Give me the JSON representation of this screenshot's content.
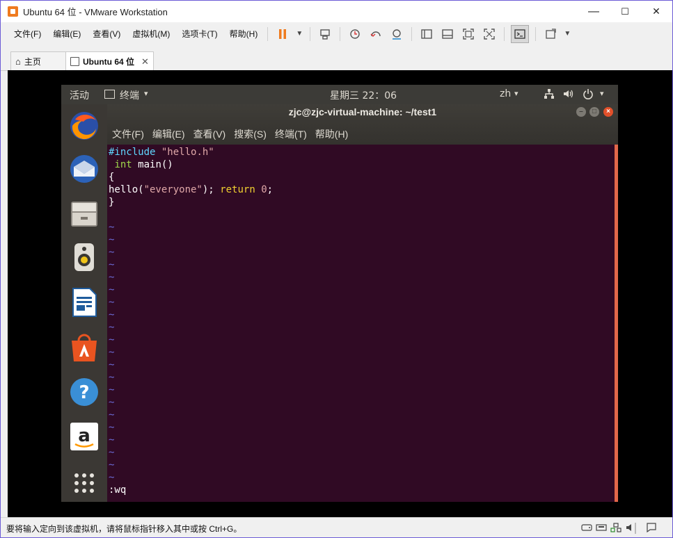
{
  "window": {
    "title": "Ubuntu 64 位 - VMware Workstation",
    "controls": {
      "minimize": "—",
      "maximize": "☐",
      "close": "✕"
    }
  },
  "menubar": {
    "items": [
      "文件(F)",
      "编辑(E)",
      "查看(V)",
      "虚拟机(M)",
      "选项卡(T)",
      "帮助(H)"
    ]
  },
  "toolbar": {
    "icons": [
      "pause-icon",
      "dropdown-arrow-icon",
      "send-ctrl-alt-del-icon",
      "snapshot-icon",
      "revert-snapshot-icon",
      "snapshot-manager-icon",
      "sidebar-icon",
      "thumbnail-bar-icon",
      "fullscreen-icon",
      "unity-icon",
      "console-view-icon",
      "stretch-icon",
      "dropdown-arrow-icon"
    ],
    "accent": "#ef7b1f"
  },
  "tabs": [
    {
      "label": "主页",
      "icon": "home-icon",
      "active": false
    },
    {
      "label": "Ubuntu 64 位",
      "icon": "vm-icon",
      "active": true,
      "close": "✕"
    }
  ],
  "ubuntu": {
    "topbar": {
      "activities": "活动",
      "app_menu": "终端",
      "clock": "星期三 22：06",
      "lang": "zh",
      "arrow": "▾"
    },
    "dock": [
      "firefox-icon",
      "thunderbird-icon",
      "files-icon",
      "rhythmbox-icon",
      "libreoffice-writer-icon",
      "software-center-icon",
      "help-icon",
      "amazon-icon",
      "show-apps-icon"
    ],
    "terminal": {
      "title": "zjc@zjc-virtual-machine: ~/test1",
      "menus": [
        "文件(F)",
        "编辑(E)",
        "查看(V)",
        "搜索(S)",
        "终端(T)",
        "帮助(H)"
      ],
      "vim": {
        "line1_directive": "#include",
        "line1_file": "\"hello.h\"",
        "line2_type": "int",
        "line2_rest": " main()",
        "line3": "{",
        "line4_call": "hello(",
        "line4_arg": "\"everyone\"",
        "line4_mid": "); ",
        "line4_return": "return",
        "line4_num": "0",
        "line4_end": ";",
        "line5": "}",
        "tilde": "~",
        "command": ":wq"
      },
      "colors": {
        "background": "#300a24",
        "scrollbar": "#e2674a"
      }
    }
  },
  "statusbar": {
    "text": "要将输入定向到该虚拟机，请将鼠标指针移入其中或按 Ctrl+G。"
  }
}
